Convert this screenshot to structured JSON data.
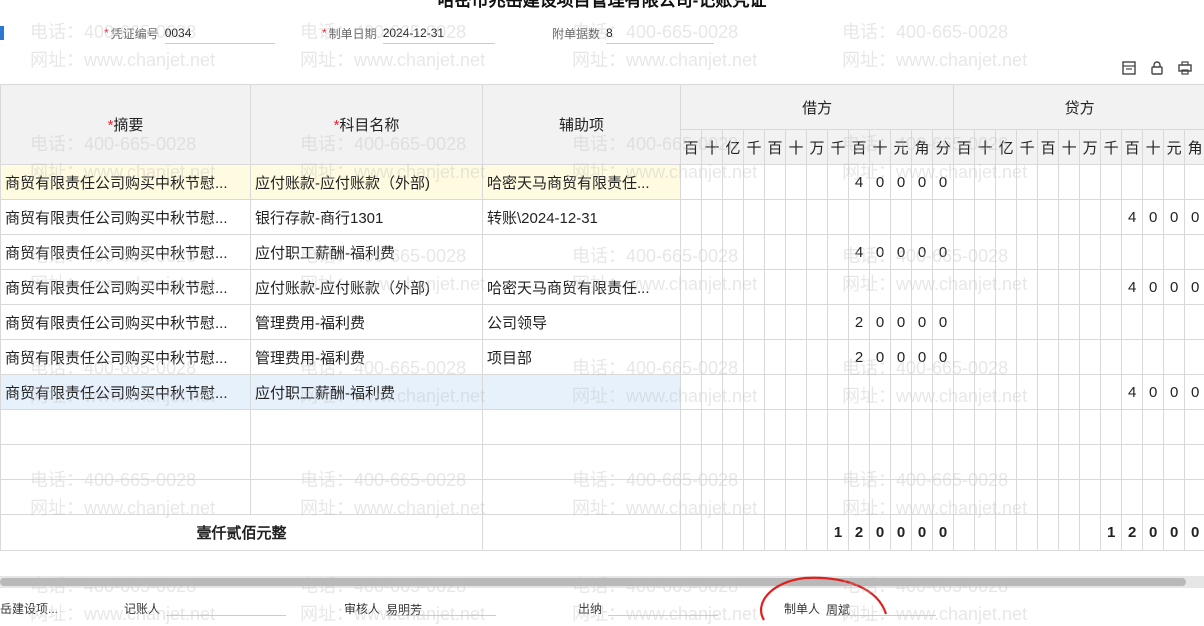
{
  "title": "哈密市兆岳建设项目管理有限公司-记账凭证",
  "header": {
    "voucher_no_label": "凭证编号",
    "voucher_no": "0034",
    "date_label": "制单日期",
    "date": "2024-12-31",
    "attach_label": "附单据数",
    "attach": "8"
  },
  "columns": {
    "summary": "摘要",
    "account": "科目名称",
    "aux": "辅助项",
    "debit": "借方",
    "credit": "贷方",
    "debit_units": [
      "百",
      "十",
      "亿",
      "千",
      "百",
      "十",
      "万",
      "千",
      "百",
      "十",
      "元",
      "角",
      "分"
    ],
    "credit_units": [
      "百",
      "十",
      "亿",
      "千",
      "百",
      "十",
      "万",
      "千",
      "百",
      "十",
      "元",
      "角"
    ]
  },
  "rows": [
    {
      "summary": "商贸有限责任公司购买中秋节慰...",
      "account": "应付账款-应付账款（外部)",
      "aux": "哈密天马商贸有限责任...",
      "debit": [
        "",
        "",
        "",
        "",
        "",
        "",
        "",
        "",
        "4",
        "0",
        "0",
        "0",
        "0"
      ],
      "credit": [
        "",
        "",
        "",
        "",
        "",
        "",
        "",
        "",
        "",
        "",
        "",
        ""
      ]
    },
    {
      "summary": "商贸有限责任公司购买中秋节慰...",
      "account": "银行存款-商行1301",
      "aux": "转账\\2024-12-31",
      "debit": [
        "",
        "",
        "",
        "",
        "",
        "",
        "",
        "",
        "",
        "",
        "",
        "",
        ""
      ],
      "credit": [
        "",
        "",
        "",
        "",
        "",
        "",
        "",
        "",
        "4",
        "0",
        "0",
        "0"
      ]
    },
    {
      "summary": "商贸有限责任公司购买中秋节慰...",
      "account": "应付职工薪酬-福利费",
      "aux": "",
      "debit": [
        "",
        "",
        "",
        "",
        "",
        "",
        "",
        "",
        "4",
        "0",
        "0",
        "0",
        "0"
      ],
      "credit": [
        "",
        "",
        "",
        "",
        "",
        "",
        "",
        "",
        "",
        "",
        "",
        ""
      ]
    },
    {
      "summary": "商贸有限责任公司购买中秋节慰...",
      "account": "应付账款-应付账款（外部)",
      "aux": "哈密天马商贸有限责任...",
      "debit": [
        "",
        "",
        "",
        "",
        "",
        "",
        "",
        "",
        "",
        "",
        "",
        "",
        ""
      ],
      "credit": [
        "",
        "",
        "",
        "",
        "",
        "",
        "",
        "",
        "4",
        "0",
        "0",
        "0"
      ]
    },
    {
      "summary": "商贸有限责任公司购买中秋节慰...",
      "account": "管理费用-福利费",
      "aux": "公司领导",
      "debit": [
        "",
        "",
        "",
        "",
        "",
        "",
        "",
        "",
        "2",
        "0",
        "0",
        "0",
        "0"
      ],
      "credit": [
        "",
        "",
        "",
        "",
        "",
        "",
        "",
        "",
        "",
        "",
        "",
        ""
      ]
    },
    {
      "summary": "商贸有限责任公司购买中秋节慰...",
      "account": "管理费用-福利费",
      "aux": "项目部",
      "debit": [
        "",
        "",
        "",
        "",
        "",
        "",
        "",
        "",
        "2",
        "0",
        "0",
        "0",
        "0"
      ],
      "credit": [
        "",
        "",
        "",
        "",
        "",
        "",
        "",
        "",
        "",
        "",
        "",
        ""
      ]
    },
    {
      "summary": "商贸有限责任公司购买中秋节慰...",
      "account": "应付职工薪酬-福利费",
      "aux": "",
      "debit": [
        "",
        "",
        "",
        "",
        "",
        "",
        "",
        "",
        "",
        "",
        "",
        "",
        ""
      ],
      "credit": [
        "",
        "",
        "",
        "",
        "",
        "",
        "",
        "",
        "4",
        "0",
        "0",
        "0"
      ]
    }
  ],
  "total": {
    "label": "壹仟贰佰元整",
    "debit": [
      "",
      "",
      "",
      "",
      "",
      "",
      "",
      "1",
      "2",
      "0",
      "0",
      "0",
      "0"
    ],
    "credit": [
      "",
      "",
      "",
      "",
      "",
      "",
      "",
      "1",
      "2",
      "0",
      "0",
      "0"
    ]
  },
  "footer": {
    "org": "岳建设项...",
    "bookkeeper_label": "记账人",
    "bookkeeper": "",
    "reviewer_label": "审核人",
    "reviewer": "易明芳",
    "cashier_label": "出纳",
    "cashier": "",
    "maker_label": "制单人",
    "maker": "周斌"
  },
  "watermark": {
    "phone": "电话：400-665-0028",
    "site": "网址：www.chanjet.net"
  },
  "icons": [
    "save-template-icon",
    "lock-icon",
    "print-icon",
    "menu-icon"
  ]
}
